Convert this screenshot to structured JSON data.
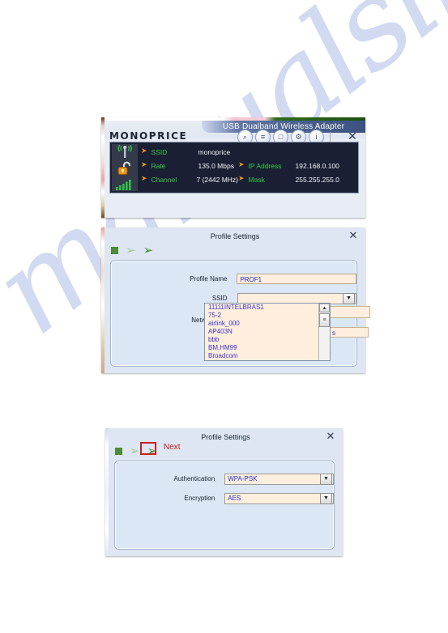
{
  "watermark": {
    "text": "manualslive.com"
  },
  "main_window": {
    "title": "USB Dualband Wireless Adapter",
    "brand": "MONOPRICE",
    "close_label": "✕",
    "toolbar_icons": [
      {
        "name": "site-survey-icon",
        "glyph": "⌕"
      },
      {
        "name": "profile-list-icon",
        "glyph": "≡"
      },
      {
        "name": "statistics-icon",
        "glyph": "□"
      },
      {
        "name": "advanced-settings-icon",
        "glyph": "⚙"
      },
      {
        "name": "about-info-icon",
        "glyph": "i"
      }
    ],
    "status": {
      "rows": [
        {
          "label": "SSID",
          "value": "monoprice",
          "label2": "",
          "value2": ""
        },
        {
          "label": "Rate",
          "value": "135.0 Mbps",
          "label2": "IP Address",
          "value2": "192.168.0.100"
        },
        {
          "label": "Channel",
          "value": "7 (2442 MHz)",
          "label2": "Mask",
          "value2": "255.255.255.0"
        }
      ],
      "indicator_icons": [
        "antenna-signal-icon",
        "open-padlock-icon",
        "signal-bars-icon"
      ]
    },
    "colors": {
      "label": "#33c94b",
      "bullet": "#e8921a",
      "value": "#f2f4f8",
      "panel_bg": "#1a1f33"
    }
  },
  "profile_window_1": {
    "title": "Profile Settings",
    "close_label": "✕",
    "toolbar": {
      "stop_label": "",
      "back_label": "←",
      "forward_label": "→"
    },
    "fields": {
      "profile_name_label": "Profile Name",
      "profile_name_value": "PROF1",
      "ssid_label": "SSID",
      "ssid_value": "",
      "network_type_label": "Network Type",
      "hidden_value": "s"
    },
    "ssid_options": [
      "11111INTELBRAS1",
      "75-2",
      "airlink_000",
      "AP403N",
      "bbb",
      "BM.HM99",
      "Broadcom"
    ],
    "scroll": {
      "up": "▲",
      "thumb": "≡",
      "down": "▼"
    },
    "dropdown_arrow": "▼"
  },
  "profile_window_2": {
    "title": "Profile Settings",
    "close_label": "✕",
    "toolbar": {
      "stop_label": "",
      "back_label": "←",
      "forward_label": "→"
    },
    "annotation": {
      "next_label": "Next",
      "highlight_color": "#c91f1f"
    },
    "fields": {
      "authentication_label": "Authentication",
      "authentication_value": "WPA-PSK",
      "encryption_label": "Encryption",
      "encryption_value": "AES"
    },
    "dropdown_arrow": "▼"
  }
}
